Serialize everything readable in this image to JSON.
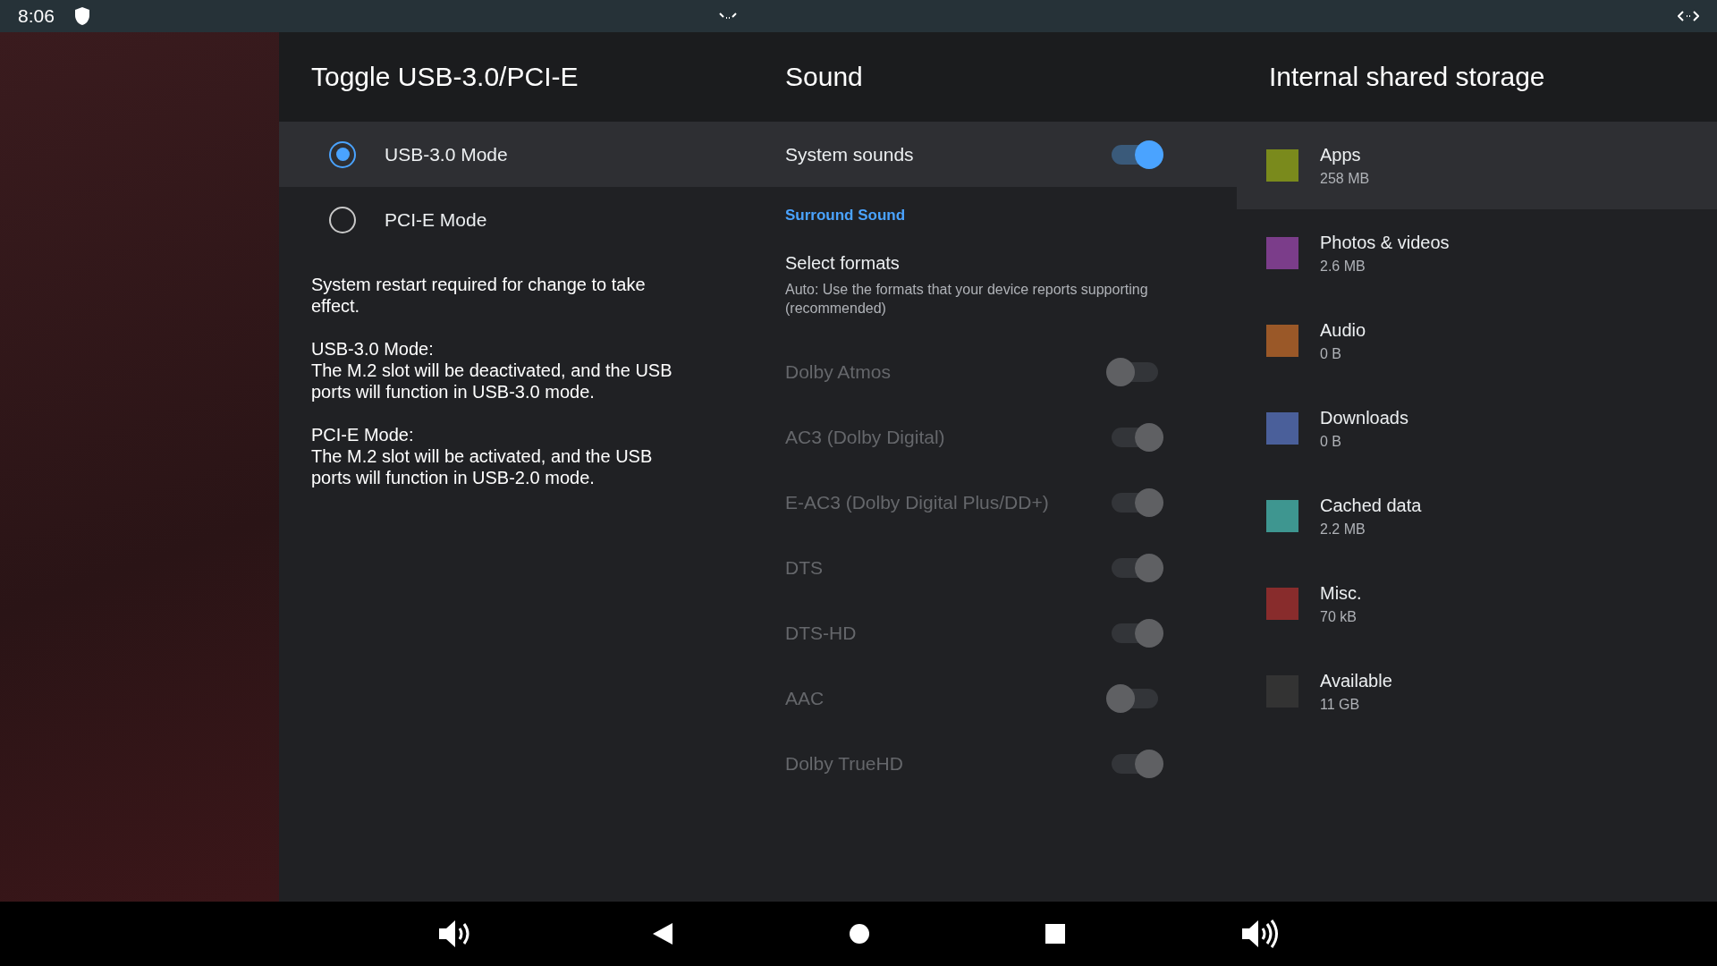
{
  "status_bar": {
    "time": "8:06"
  },
  "usb_panel": {
    "title": "Toggle USB-3.0/PCI-E",
    "options": [
      {
        "label": "USB-3.0 Mode",
        "selected": true
      },
      {
        "label": "PCI-E Mode",
        "selected": false
      }
    ],
    "paragraphs": [
      "System restart required for change to take effect.",
      "USB-3.0 Mode:\nThe M.2 slot will be deactivated, and the USB ports will function in USB-3.0 mode.",
      "PCI-E Mode:\nThe M.2 slot will be activated, and the USB ports will function in USB-2.0 mode."
    ]
  },
  "sound_panel": {
    "title": "Sound",
    "system_sounds": {
      "label": "System sounds",
      "on": true,
      "selected": true
    },
    "section": "Surround Sound",
    "select_formats": {
      "title": "Select formats",
      "summary": "Auto: Use the formats that your device reports supporting (recommended)"
    },
    "formats": [
      {
        "label": "Dolby Atmos",
        "on": false,
        "disabled": true
      },
      {
        "label": "AC3 (Dolby Digital)",
        "on": true,
        "disabled": true
      },
      {
        "label": "E-AC3 (Dolby Digital Plus/DD+)",
        "on": true,
        "disabled": true
      },
      {
        "label": "DTS",
        "on": true,
        "disabled": true
      },
      {
        "label": "DTS-HD",
        "on": true,
        "disabled": true
      },
      {
        "label": "AAC",
        "on": false,
        "disabled": true
      },
      {
        "label": "Dolby TrueHD",
        "on": true,
        "disabled": true
      }
    ]
  },
  "storage_panel": {
    "title": "Internal shared storage",
    "items": [
      {
        "name": "Apps",
        "size": "258 MB",
        "color": "#7a8a1c",
        "selected": true
      },
      {
        "name": "Photos & videos",
        "size": "2.6 MB",
        "color": "#7b3d8a",
        "selected": false
      },
      {
        "name": "Audio",
        "size": "0 B",
        "color": "#9a5828",
        "selected": false
      },
      {
        "name": "Downloads",
        "size": "0 B",
        "color": "#4a5f9a",
        "selected": false
      },
      {
        "name": "Cached data",
        "size": "2.2 MB",
        "color": "#3e9690",
        "selected": false
      },
      {
        "name": "Misc.",
        "size": "70 kB",
        "color": "#882c2c",
        "selected": false
      },
      {
        "name": "Available",
        "size": "11 GB",
        "color": "#333333",
        "selected": false
      }
    ]
  }
}
